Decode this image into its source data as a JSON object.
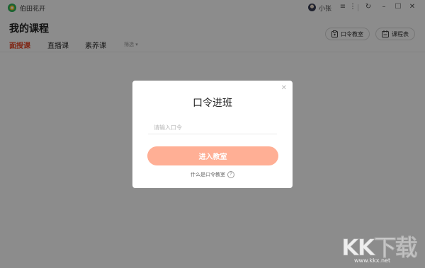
{
  "app": {
    "name": "伯田花开"
  },
  "user": {
    "name": "小张"
  },
  "page": {
    "title": "我的课程"
  },
  "header_buttons": {
    "code_classroom": "口令教室",
    "schedule": "课程表"
  },
  "tabs": [
    {
      "label": "面授课",
      "active": true
    },
    {
      "label": "直播课",
      "active": false
    },
    {
      "label": "素养课",
      "active": false
    }
  ],
  "filter": {
    "label": "筛选"
  },
  "dialog": {
    "title": "口令进班",
    "input_placeholder": "请输入口令",
    "input_value": "",
    "submit_label": "进入教室",
    "help_text": "什么是口令教室"
  },
  "watermark": {
    "text": "KK下载",
    "url": "www.kkx.net"
  },
  "colors": {
    "accent": "#e8492a",
    "button": "#ffaf95",
    "overlay": "rgba(0,0,0,0.45)"
  }
}
